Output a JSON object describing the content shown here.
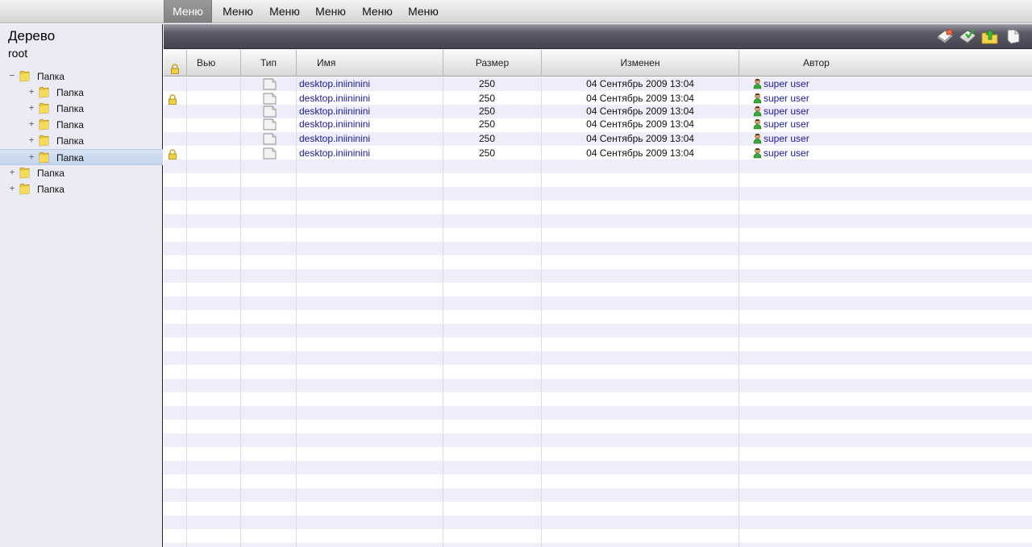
{
  "menubar": {
    "items": [
      {
        "label": "Меню",
        "active": true
      },
      {
        "label": "Меню",
        "active": false
      },
      {
        "label": "Меню",
        "active": false
      },
      {
        "label": "Меню",
        "active": false
      },
      {
        "label": "Меню",
        "active": false
      },
      {
        "label": "Меню",
        "active": false
      }
    ]
  },
  "tree": {
    "title": "Дерево",
    "root": "root",
    "nodes": [
      {
        "label": "Папка",
        "toggle": "−",
        "level": 0,
        "selected": false
      },
      {
        "label": "Папка",
        "toggle": "+",
        "level": 1,
        "selected": false
      },
      {
        "label": "Папка",
        "toggle": "+",
        "level": 1,
        "selected": false
      },
      {
        "label": "Папка",
        "toggle": "+",
        "level": 1,
        "selected": false
      },
      {
        "label": "Папка",
        "toggle": "+",
        "level": 1,
        "selected": false
      },
      {
        "label": "Папка",
        "toggle": "+",
        "level": 1,
        "selected": true
      },
      {
        "label": "Папка",
        "toggle": "+",
        "level": 0,
        "selected": false
      },
      {
        "label": "Папка",
        "toggle": "+",
        "level": 0,
        "selected": false
      }
    ]
  },
  "toolbar": {
    "buttons": [
      "new-doc-icon",
      "checkout-icon",
      "upload-folder-icon",
      "document-icon"
    ]
  },
  "grid": {
    "columns": [
      "",
      "Вью",
      "Тип",
      "Имя",
      "Размер",
      "Изменен",
      "Автор"
    ],
    "rows": [
      {
        "locked": false,
        "name": "desktop.iniininini",
        "size": "250",
        "modified": "04 Сентябрь 2009 13:04",
        "author": "super user"
      },
      {
        "locked": true,
        "name": "desktop.iniininini",
        "size": "250",
        "modified": "04 Сентябрь 2009 13:04",
        "author": "super user"
      },
      {
        "locked": false,
        "name": "desktop.iniininini",
        "size": "250",
        "modified": "04 Сентябрь 2009 13:04",
        "author": "super user"
      },
      {
        "locked": false,
        "name": "desktop.iniininini",
        "size": "250",
        "modified": "04 Сентябрь 2009 13:04",
        "author": "super user"
      },
      {
        "locked": false,
        "name": "desktop.iniininini",
        "size": "250",
        "modified": "04 Сентябрь 2009 13:04",
        "author": "super user"
      },
      {
        "locked": true,
        "name": "desktop.iniininini",
        "size": "250",
        "modified": "04 Сентябрь 2009 13:04",
        "author": "super user"
      }
    ]
  },
  "colors": {
    "link": "#1a1a9a",
    "stripe": "#eeeefa",
    "tree_bg": "#ebebf3",
    "selected": "#c2d4ec"
  }
}
